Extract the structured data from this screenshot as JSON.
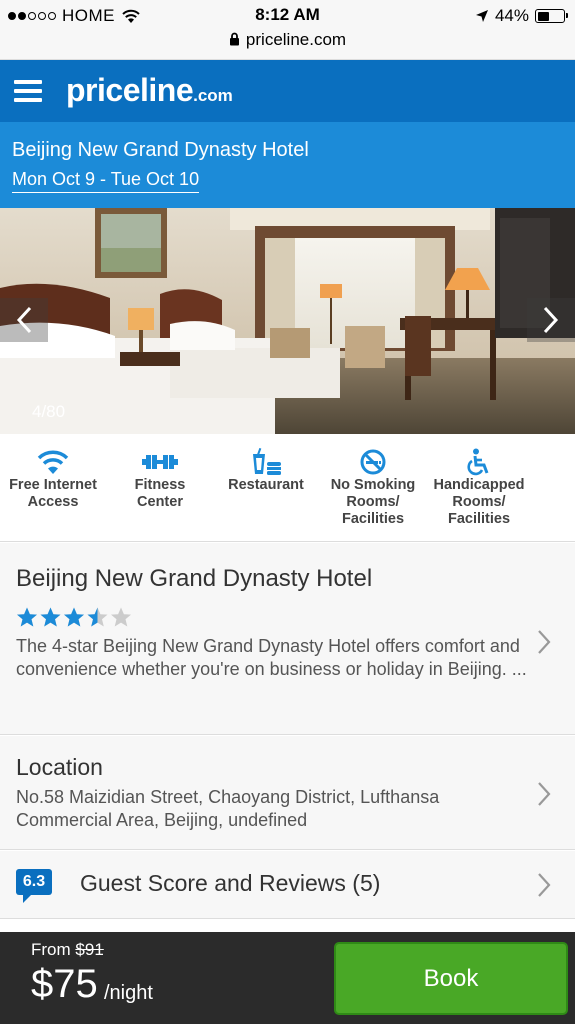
{
  "status_bar": {
    "carrier": "HOME",
    "time": "8:12 AM",
    "battery_percent": "44%",
    "battery_level": 0.44
  },
  "browser": {
    "url": "priceline.com"
  },
  "header": {
    "logo_main": "priceline",
    "logo_suffix": ".com",
    "brand_color": "#0a6fbf"
  },
  "hotel_header": {
    "name": "Beijing New Grand Dynasty Hotel",
    "dates": "Mon Oct 9 - Tue Oct 10"
  },
  "gallery": {
    "counter": "4/80"
  },
  "amenities": [
    {
      "icon": "wifi-icon",
      "label_lines": [
        "Free Internet",
        "Access"
      ]
    },
    {
      "icon": "dumbbell-icon",
      "label_lines": [
        "Fitness",
        "Center"
      ]
    },
    {
      "icon": "restaurant-icon",
      "label_lines": [
        "Restaurant"
      ]
    },
    {
      "icon": "no-smoking-icon",
      "label_lines": [
        "No Smoking",
        "Rooms/",
        "Facilities"
      ]
    },
    {
      "icon": "wheelchair-icon",
      "label_lines": [
        "Handicapped",
        "Rooms/",
        "Facilities"
      ]
    }
  ],
  "overview": {
    "title": "Beijing New Grand Dynasty Hotel",
    "star_rating": 3.5,
    "star_max": 5,
    "description": "The 4-star Beijing New Grand Dynasty Hotel offers comfort and convenience whether you're on business or holiday in Beijing. ..."
  },
  "location": {
    "title": "Location",
    "address": "No.58 Maizidian Street, Chaoyang District, Lufthansa Commercial Area, Beijing, undefined"
  },
  "reviews": {
    "score": "6.3",
    "title": "Guest Score and Reviews (5)"
  },
  "booking": {
    "from_label": "From",
    "original_price": "$91",
    "price": "$75",
    "per": "/night",
    "book_label": "Book",
    "book_color": "#49a826"
  }
}
